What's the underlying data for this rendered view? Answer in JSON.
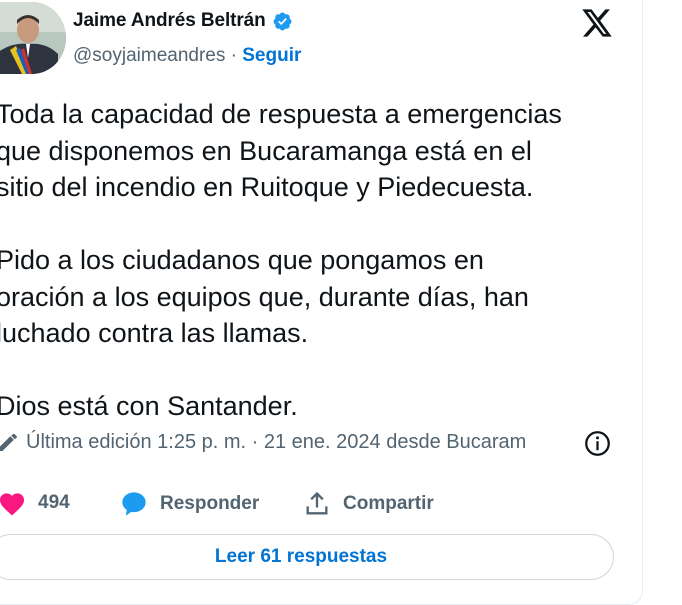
{
  "author": {
    "name": "Jaime Andrés Beltrán",
    "handle": "@soyjaimeandres",
    "separator": "·",
    "follow_label": "Seguir"
  },
  "icons": {
    "avatar": "profile-photo",
    "verified": "verified-badge-icon",
    "platform": "x-logo-icon",
    "edit": "pencil-icon",
    "info": "info-icon",
    "like": "heart-icon",
    "reply": "speech-bubble-icon",
    "share": "share-upload-icon"
  },
  "colors": {
    "link_blue": "#0074d4",
    "verified_blue": "#1d9bf0",
    "like_pink": "#f91880",
    "text_primary": "#0f1419",
    "text_secondary": "#536471"
  },
  "tweet": {
    "lines": [
      "Toda la capacidad de respuesta a emergencias",
      "que disponemos en Bucaramanga está en el",
      "sitio del incendio en Ruitoque y Piedecuesta."
    ],
    "lines2": [
      "Pido a los ciudadanos que pongamos en",
      "oración a los equipos que, durante días, han",
      "luchado contra las llamas."
    ],
    "lines3": [
      "Dios está con Santander."
    ]
  },
  "meta": {
    "edited": "Última edición 1:25 p. m. · 21 ene. 2024 desde Bucaram"
  },
  "actions": {
    "likes_count": "494",
    "reply_label": "Responder",
    "share_label": "Compartir"
  },
  "replies_button": "Leer 61 respuestas"
}
